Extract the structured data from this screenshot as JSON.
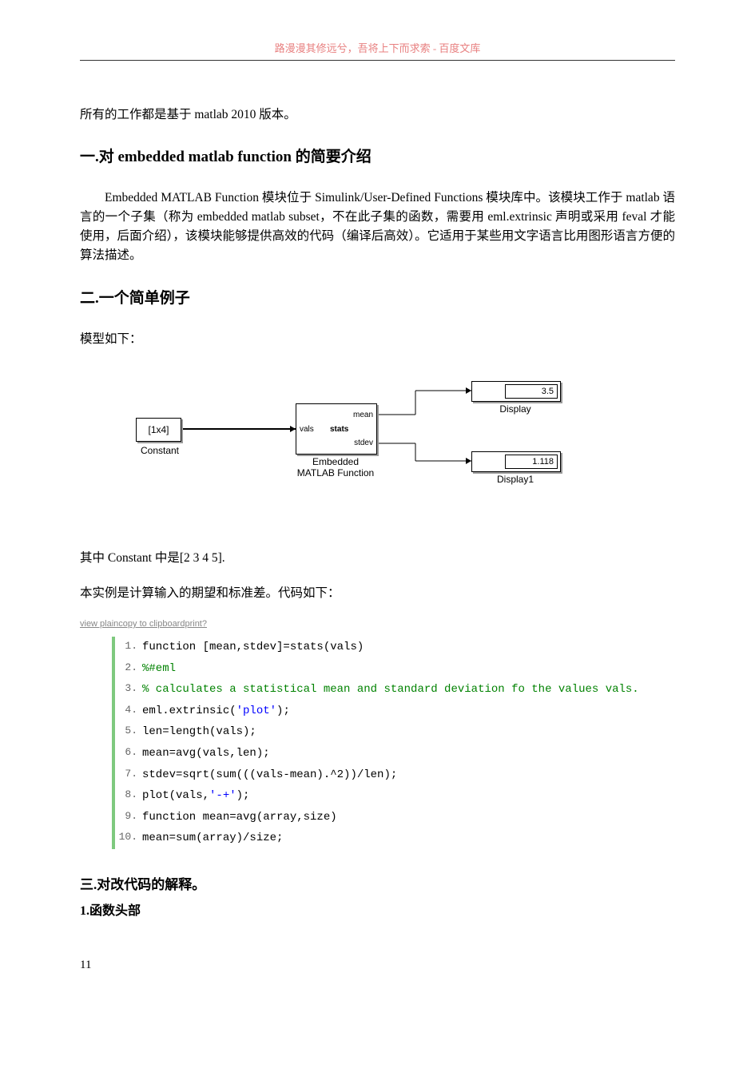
{
  "header": "路漫漫其修远兮，吾将上下而求索 - 百度文库",
  "intro": "所有的工作都是基于 matlab 2010 版本。",
  "sec1": {
    "title": "一.对 embedded matlab function 的简要介绍",
    "body": "Embedded MATLAB Function 模块位于 Simulink/User-Defined Functions 模块库中。该模块工作于 matlab 语言的一个子集（称为 embedded matlab subset，不在此子集的函数，需要用 eml.extrinsic 声明或采用 feval 才能使用，后面介绍），该模块能够提供高效的代码（编译后高效）。它适用于某些用文字语言比用图形语言方便的算法描述。"
  },
  "sec2": {
    "title": "二.一个简单例子",
    "modelline": "模型如下：",
    "diagram": {
      "constant_text": "[1x4]",
      "constant_label": "Constant",
      "block_ports_in": "vals",
      "block_center": "stats",
      "block_port_mean": "mean",
      "block_port_stdev": "stdev",
      "block_label_top": "Embedded",
      "block_label_bot": "MATLAB Function",
      "display1_val": "3.5",
      "display1_label": "Display",
      "display2_val": "1.118",
      "display2_label": "Display1"
    },
    "constant_line": "其中 Constant 中是[2 3 4 5].",
    "desc_line": "本实例是计算输入的期望和标准差。代码如下：",
    "toolbar": "view plaincopy to clipboardprint?",
    "code": [
      {
        "n": "1.",
        "plain": "function [mean,stdev]=stats(vals)"
      },
      {
        "n": "2.",
        "comment": "%#eml"
      },
      {
        "n": "3.",
        "comment": "% calculates a statistical mean and standard deviation fo the values vals."
      },
      {
        "n": "4.",
        "pre": "eml.extrinsic(",
        "str": "'plot'",
        "post": ");"
      },
      {
        "n": "5.",
        "plain": "len=length(vals);"
      },
      {
        "n": "6.",
        "plain": "mean=avg(vals,len);"
      },
      {
        "n": "7.",
        "plain": "stdev=sqrt(sum(((vals-mean).^2))/len);"
      },
      {
        "n": "8.",
        "pre": "plot(vals,",
        "str": "'-+'",
        "post": ");"
      },
      {
        "n": "9.",
        "plain": "function mean=avg(array,size)"
      },
      {
        "n": "10.",
        "plain": "mean=sum(array)/size;"
      }
    ]
  },
  "sec3": {
    "title": "三.对改代码的解释。",
    "sub1": "1.函数头部"
  },
  "pagenum": "11"
}
